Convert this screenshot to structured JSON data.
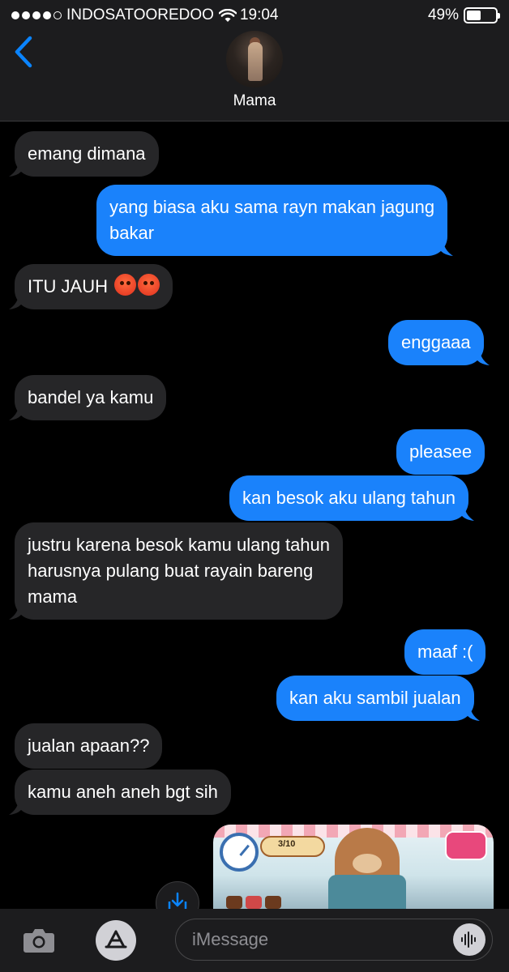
{
  "status_bar": {
    "carrier": "INDOSATOOREDOO",
    "time": "19:04",
    "battery_percent": "49%",
    "battery_level": 0.49
  },
  "header": {
    "contact_name": "Mama"
  },
  "messages": [
    {
      "dir": "in",
      "text": "emang dimana"
    },
    {
      "dir": "out",
      "lines": [
        "yang biasa aku sama rayn makan jagung",
        "bakar"
      ]
    },
    {
      "dir": "in",
      "text": "ITU JAUH",
      "emoji": "😡😡"
    },
    {
      "dir": "out",
      "text": "enggaaa"
    },
    {
      "dir": "in",
      "text": "bandel ya kamu"
    },
    {
      "dir": "out",
      "text": "pleasee"
    },
    {
      "dir": "out",
      "text": "kan besok aku ulang tahun"
    },
    {
      "dir": "in",
      "lines": [
        "justru karena besok kamu ulang tahun",
        "harusnya pulang buat rayain bareng",
        "mama"
      ]
    },
    {
      "dir": "out",
      "text": "maaf :("
    },
    {
      "dir": "out",
      "text": "kan aku sambil jualan"
    },
    {
      "dir": "in",
      "text": "jualan apaan??"
    },
    {
      "dir": "in",
      "text": "kamu aneh aneh bgt sih"
    }
  ],
  "photo": {
    "counter": "3/10"
  },
  "composer": {
    "placeholder": "iMessage"
  },
  "icons": {
    "back": "chevron-left-icon",
    "camera": "camera-icon",
    "apps": "app-store-icon",
    "audio": "waveform-icon",
    "scroll": "scroll-down-icon"
  },
  "colors": {
    "outgoing_bubble": "#1a82fb",
    "incoming_bubble": "#262628",
    "accent": "#0a84ff"
  }
}
